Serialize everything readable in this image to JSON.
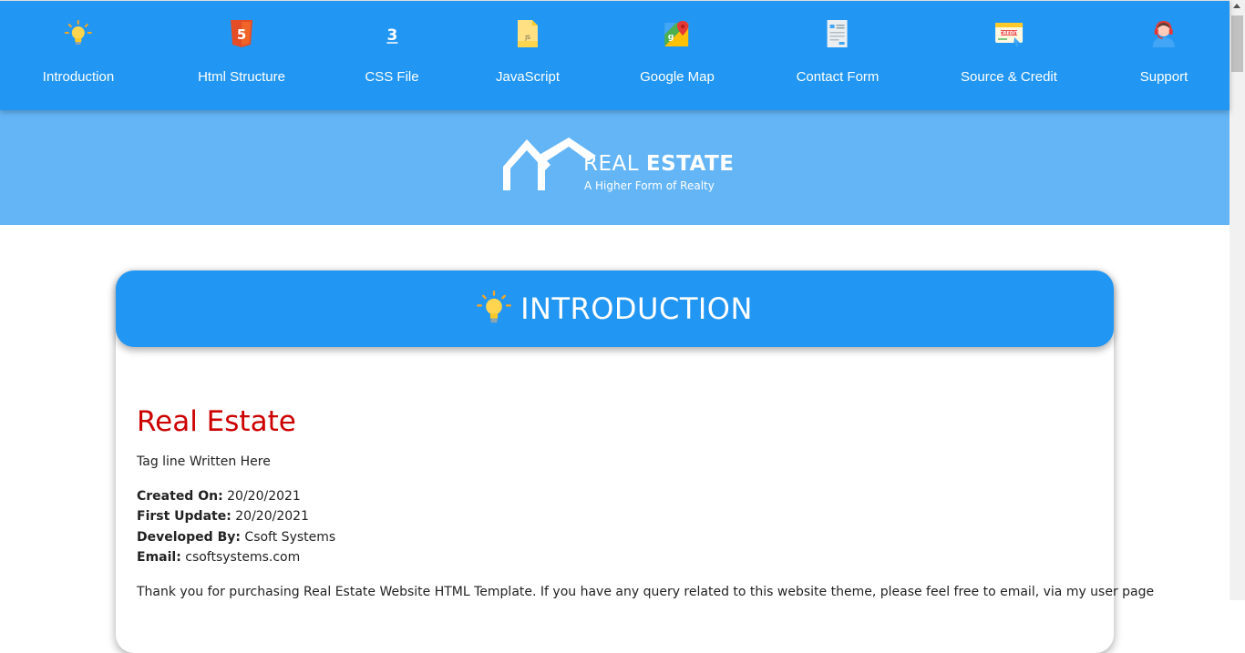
{
  "nav": {
    "items": [
      {
        "label": "Introduction",
        "icon": "lightbulb-icon"
      },
      {
        "label": "Html Structure",
        "icon": "html5-icon"
      },
      {
        "label": "CSS File",
        "icon": "css3-icon"
      },
      {
        "label": "JavaScript",
        "icon": "js-file-icon"
      },
      {
        "label": "Google Map",
        "icon": "google-maps-icon"
      },
      {
        "label": "Contact Form",
        "icon": "form-icon"
      },
      {
        "label": "Source & Credit",
        "icon": "credit-icon"
      },
      {
        "label": "Support",
        "icon": "support-agent-icon"
      }
    ]
  },
  "banner": {
    "logo_word_light": "REAL ",
    "logo_word_bold": "ESTATE",
    "logo_tagline": "A Higher Form of Realty"
  },
  "section": {
    "title": "INTRODUCTION",
    "project_name": "Real Estate",
    "tagline": "Tag line Written Here",
    "created_label": "Created On:",
    "created_value": "20/20/2021",
    "updated_label": "First Update:",
    "updated_value": "20/20/2021",
    "developer_label": "Developed By:",
    "developer_value": "Csoft Systems",
    "email_label": "Email:",
    "email_value": "csoftsystems.com",
    "paragraph": "Thank you for purchasing Real Estate Website HTML Template. If you have any query related to this website theme, please feel free to email, via my user page"
  },
  "colors": {
    "nav_bg": "#2196f3",
    "banner_bg": "#64b5f6",
    "project_name": "#cc0000"
  }
}
